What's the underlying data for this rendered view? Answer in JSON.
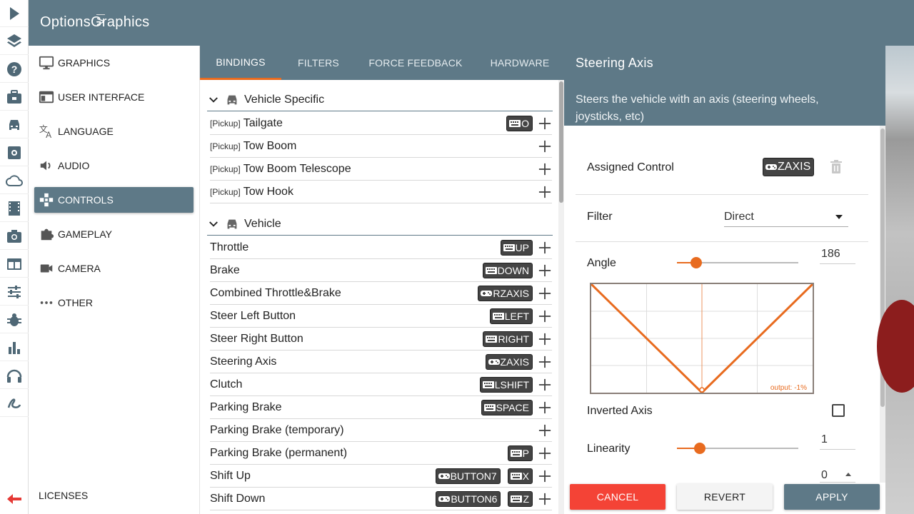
{
  "header": {
    "crumb_root": "Options",
    "crumb_sep": ">",
    "crumb_page": "Graphics"
  },
  "rail": [
    {
      "icon": "play-icon"
    },
    {
      "icon": "layers-icon"
    },
    {
      "icon": "help-icon"
    },
    {
      "icon": "briefcase-icon"
    },
    {
      "icon": "car-icon"
    },
    {
      "icon": "settings-icon"
    },
    {
      "icon": "cloud-icon"
    },
    {
      "icon": "film-icon"
    },
    {
      "icon": "camera-icon"
    },
    {
      "icon": "window-icon"
    },
    {
      "icon": "sliders-icon"
    },
    {
      "icon": "bug-icon"
    },
    {
      "icon": "bar-chart-icon"
    },
    {
      "icon": "headphones-icon"
    },
    {
      "icon": "scribble-icon"
    }
  ],
  "categories": [
    {
      "label": "GRAPHICS",
      "icon": "monitor-icon"
    },
    {
      "label": "USER INTERFACE",
      "icon": "interface-icon"
    },
    {
      "label": "LANGUAGE",
      "icon": "translate-icon"
    },
    {
      "label": "AUDIO",
      "icon": "speaker-icon"
    },
    {
      "label": "CONTROLS",
      "icon": "gamepad-icon"
    },
    {
      "label": "GAMEPLAY",
      "icon": "puzzle-icon"
    },
    {
      "label": "CAMERA",
      "icon": "video-camera-icon"
    },
    {
      "label": "OTHER",
      "icon": "more-icon"
    }
  ],
  "licenses": "LICENSES",
  "tabs": [
    "BINDINGS",
    "FILTERS",
    "FORCE FEEDBACK",
    "HARDWARE"
  ],
  "groups": [
    "Vehicle Specific",
    "Vehicle"
  ],
  "bindings": [
    {
      "prefix": "[Pickup]",
      "name": "Tailgate",
      "keys": [
        {
          "type": "keyboard",
          "label": "O"
        }
      ]
    },
    {
      "prefix": "[Pickup]",
      "name": "Tow Boom",
      "keys": []
    },
    {
      "prefix": "[Pickup]",
      "name": "Tow Boom Telescope",
      "keys": []
    },
    {
      "prefix": "[Pickup]",
      "name": "Tow Hook",
      "keys": []
    },
    {
      "prefix": "",
      "name": "Throttle",
      "keys": [
        {
          "type": "keyboard",
          "label": "UP"
        }
      ]
    },
    {
      "prefix": "",
      "name": "Brake",
      "keys": [
        {
          "type": "keyboard",
          "label": "DOWN"
        }
      ]
    },
    {
      "prefix": "",
      "name": "Combined Throttle&Brake",
      "keys": [
        {
          "type": "gamepad",
          "label": "RZAXIS"
        }
      ]
    },
    {
      "prefix": "",
      "name": "Steer Left Button",
      "keys": [
        {
          "type": "keyboard",
          "label": "LEFT"
        }
      ]
    },
    {
      "prefix": "",
      "name": "Steer Right Button",
      "keys": [
        {
          "type": "keyboard",
          "label": "RIGHT"
        }
      ]
    },
    {
      "prefix": "",
      "name": "Steering Axis",
      "keys": [
        {
          "type": "gamepad",
          "label": "ZAXIS"
        }
      ]
    },
    {
      "prefix": "",
      "name": "Clutch",
      "keys": [
        {
          "type": "keyboard",
          "label": "LSHIFT"
        }
      ]
    },
    {
      "prefix": "",
      "name": "Parking Brake",
      "keys": [
        {
          "type": "keyboard",
          "label": "SPACE"
        }
      ]
    },
    {
      "prefix": "",
      "name": "Parking Brake (temporary)",
      "keys": []
    },
    {
      "prefix": "",
      "name": "Parking Brake (permanent)",
      "keys": [
        {
          "type": "keyboard",
          "label": "P"
        }
      ]
    },
    {
      "prefix": "",
      "name": "Shift Up",
      "keys": [
        {
          "type": "gamepad",
          "label": "BUTTON7"
        },
        {
          "type": "keyboard",
          "label": "X"
        }
      ]
    },
    {
      "prefix": "",
      "name": "Shift Down",
      "keys": [
        {
          "type": "gamepad",
          "label": "BUTTON6"
        },
        {
          "type": "keyboard",
          "label": "Z"
        }
      ]
    }
  ],
  "detail": {
    "title": "Steering Axis",
    "description": "Steers the vehicle with an axis (steering wheels, joysticks, etc)",
    "assigned_label": "Assigned Control",
    "assigned_key": "ZAXIS",
    "filter_label": "Filter",
    "filter_value": "Direct",
    "angle_label": "Angle",
    "angle_value": "186",
    "angle_fraction": 0.16,
    "graph_output": "output: -1%",
    "inverted_label": "Inverted Axis",
    "inverted_checked": false,
    "linearity_label": "Linearity",
    "linearity_value": "1",
    "linearity_fraction": 0.19,
    "next_value": "0"
  },
  "buttons": {
    "cancel": "CANCEL",
    "revert": "REVERT",
    "apply": "APPLY"
  },
  "colors": {
    "accent": "#e86b1f",
    "header": "#5e7987",
    "cancel": "#f44336"
  }
}
